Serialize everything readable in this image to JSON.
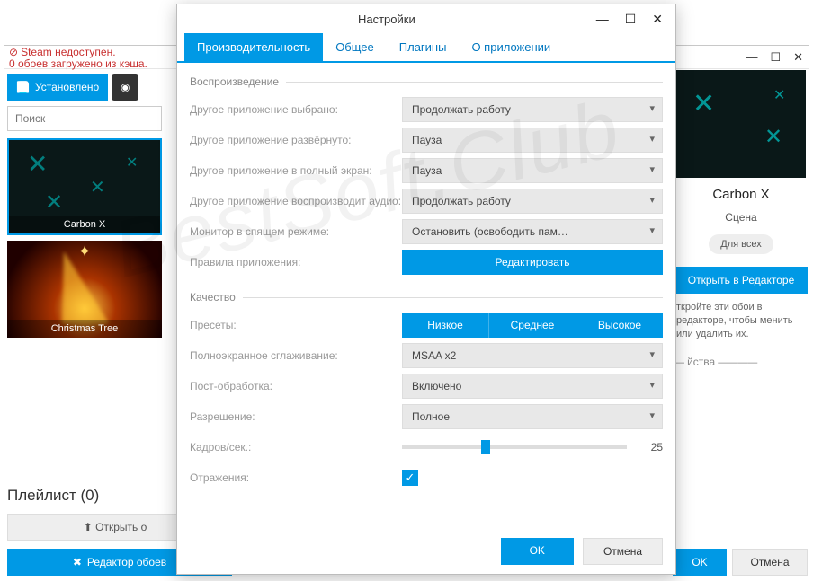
{
  "errors": {
    "line1": "Steam недоступен.",
    "line2": "0 обоев загружено из кэша."
  },
  "leftTabs": {
    "installed": "Установлено"
  },
  "search": {
    "placeholder": "Поиск"
  },
  "thumbs": {
    "t1": "Carbon X",
    "t2": "Christmas Tree"
  },
  "playlist": {
    "title": "Плейлист (0)",
    "open": "Открыть о"
  },
  "bottom": {
    "editor": "Редактор обоев",
    "ok": "OK",
    "cancel": "Отмена"
  },
  "right": {
    "title": "Carbon X",
    "sub": "Сцена",
    "pill": "Для всех",
    "openEditor": "Открыть в Редакторе",
    "desc": "ткройте эти обои в редакторе, чтобы менить или удалить их.",
    "section": "йства"
  },
  "modal": {
    "title": "Настройки",
    "tabs": {
      "perf": "Производительность",
      "general": "Общее",
      "plugins": "Плагины",
      "about": "О приложении"
    },
    "playback": {
      "legend": "Воспроизведение",
      "otherSelected": "Другое приложение выбрано:",
      "otherSelectedVal": "Продолжать работу",
      "otherExpanded": "Другое приложение развёрнуто:",
      "otherExpandedVal": "Пауза",
      "otherFull": "Другое приложение в полный экран:",
      "otherFullVal": "Пауза",
      "otherAudio": "Другое приложение воспроизводит аудио:",
      "otherAudioVal": "Продолжать работу",
      "sleep": "Монитор в спящем режиме:",
      "sleepVal": "Остановить (освободить пам…",
      "rules": "Правила приложения:",
      "rulesBtn": "Редактировать"
    },
    "quality": {
      "legend": "Качество",
      "presets": "Пресеты:",
      "presetLow": "Низкое",
      "presetMid": "Среднее",
      "presetHigh": "Высокое",
      "aa": "Полноэкранное сглаживание:",
      "aaVal": "MSAA x2",
      "post": "Пост-обработка:",
      "postVal": "Включено",
      "res": "Разрешение:",
      "resVal": "Полное",
      "fps": "Кадров/сек.:",
      "fpsVal": "25",
      "refl": "Отражения:"
    },
    "ok": "OK",
    "cancel": "Отмена"
  },
  "watermark": "BestSoft.Club"
}
